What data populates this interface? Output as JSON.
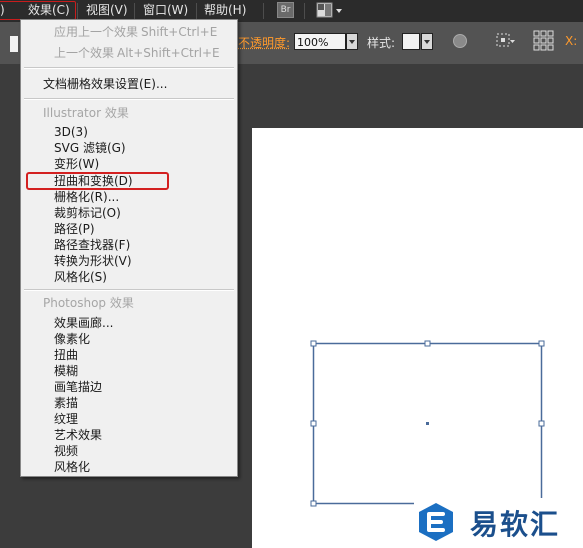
{
  "menubar": {
    "items": [
      {
        "label": ")"
      },
      {
        "label": "效果(C)"
      },
      {
        "label": "视图(V)"
      },
      {
        "label": "窗口(W)"
      },
      {
        "label": "帮助(H)"
      }
    ],
    "bridge_label": "Br"
  },
  "controlbar": {
    "opacity_label": "不透明度:",
    "opacity_value": "100%",
    "style_label": "样式:",
    "x_label": "X:"
  },
  "effect_menu": {
    "recent": [
      {
        "label": "应用上一个效果",
        "shortcut": "Shift+Ctrl+E"
      },
      {
        "label": "上一个效果",
        "shortcut": "Alt+Shift+Ctrl+E"
      }
    ],
    "document_raster": "文档栅格效果设置(E)...",
    "illustrator_header": "Illustrator 效果",
    "illustrator_items": [
      "3D(3)",
      "SVG 滤镜(G)",
      "变形(W)",
      "扭曲和变换(D)",
      "栅格化(R)...",
      "裁剪标记(O)",
      "路径(P)",
      "路径查找器(F)",
      "转换为形状(V)",
      "风格化(S)"
    ],
    "photoshop_header": "Photoshop 效果",
    "photoshop_items": [
      "效果画廊...",
      "像素化",
      "扭曲",
      "模糊",
      "画笔描边",
      "素描",
      "纹理",
      "艺术效果",
      "视频",
      "风格化"
    ]
  },
  "highlight_color": "#d32020",
  "accent_color": "#ff9a2c",
  "logo": {
    "text": "易软汇"
  }
}
